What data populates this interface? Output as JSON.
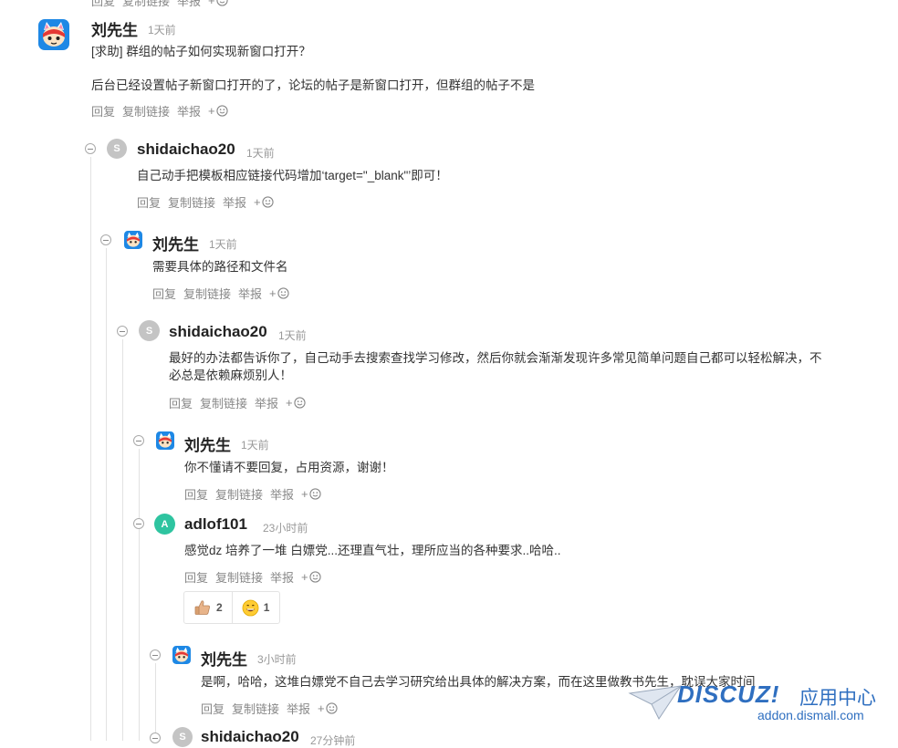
{
  "actions": {
    "reply": "回复",
    "copy_link": "复制链接",
    "report": "举报",
    "add_reaction": "+"
  },
  "comments": [
    {
      "author": "刘先生",
      "time": "1天前",
      "lines": [
        "[求助] 群组的帖子如何实现新窗口打开？",
        "后台已经设置帖子新窗口打开的了，论坛的帖子是新窗口打开，但群组的帖子不是"
      ],
      "avatar": "cartoon-icon"
    },
    {
      "author": "shidaichao20",
      "time": "1天前",
      "lines": [
        "自己动手把模板相应链接代码增加‘target=\"_blank\"’即可！"
      ],
      "avatar_letter": "S"
    },
    {
      "author": "刘先生",
      "time": "1天前",
      "lines": [
        "需要具体的路径和文件名"
      ],
      "avatar": "cartoon-icon"
    },
    {
      "author": "shidaichao20",
      "time": "1天前",
      "lines": [
        "最好的办法都告诉你了，自己动手去搜索查找学习修改，然后你就会渐渐发现许多常见简单问题自己都可以轻松解决，不",
        "必总是依赖麻烦别人！"
      ],
      "avatar_letter": "S"
    },
    {
      "author": "刘先生",
      "time": "1天前",
      "lines": [
        "你不懂请不要回复，占用资源，谢谢！"
      ],
      "avatar": "cartoon-icon"
    },
    {
      "author": "adlof101",
      "time": "23小时前",
      "lines": [
        "感觉dz 培养了一堆 白嫖党...还理直气壮，理所应当的各种要求..哈哈.."
      ],
      "avatar_letter": "A",
      "reactions": [
        {
          "icon": "thumbs-up-icon",
          "count": "2"
        },
        {
          "icon": "grin-icon",
          "count": "1"
        }
      ]
    },
    {
      "author": "刘先生",
      "time": "3小时前",
      "lines": [
        "是啊，哈哈，这堆白嫖党不自己去学习研究给出具体的解决方案，而在这里做教书先生，耽误大家时间"
      ],
      "avatar": "cartoon-icon"
    },
    {
      "author": "shidaichao20",
      "time": "27分钟前",
      "avatar_letter": "S"
    }
  ],
  "watermark": {
    "brand": "DISCUZ!",
    "cn": "应用中心",
    "url": "addon.dismall.com"
  },
  "colors": {
    "avatar_grey": "#c4c4c4",
    "avatar_green": "#2ec4a0",
    "watermark_blue": "#2f6fc0"
  }
}
